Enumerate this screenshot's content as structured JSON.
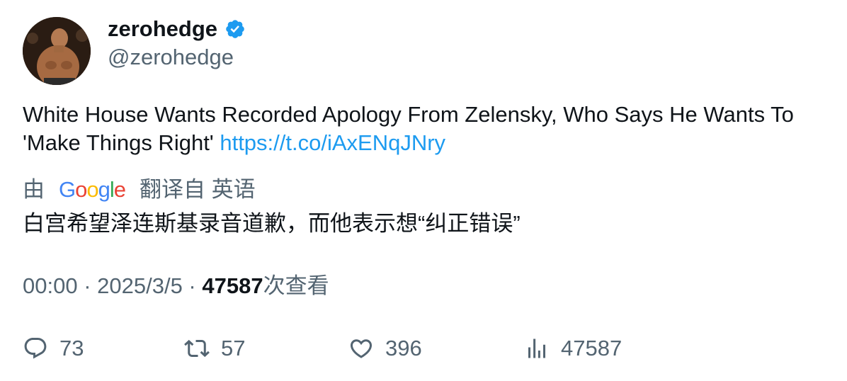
{
  "author": {
    "display_name": "zerohedge",
    "handle": "@zerohedge",
    "verified": true
  },
  "tweet": {
    "text": "White House Wants Recorded Apology From Zelensky, Who Says He Wants To 'Make Things Right' ",
    "link": "https://t.co/iAxENqJNry"
  },
  "translation": {
    "prefix": "由",
    "provider": "Google",
    "suffix": "翻译自 英语",
    "text": "白宫希望泽连斯基录音道歉，而他表示想“纠正错误”"
  },
  "meta": {
    "time": "00:00",
    "separator": " · ",
    "date": "2025/3/5",
    "views": "47587",
    "views_label": "次查看"
  },
  "actions": {
    "replies": "73",
    "retweets": "57",
    "likes": "396",
    "views": "47587"
  },
  "colors": {
    "link": "#1d9bf0",
    "secondary_text": "#536471",
    "verified_badge": "#1d9bf0"
  }
}
